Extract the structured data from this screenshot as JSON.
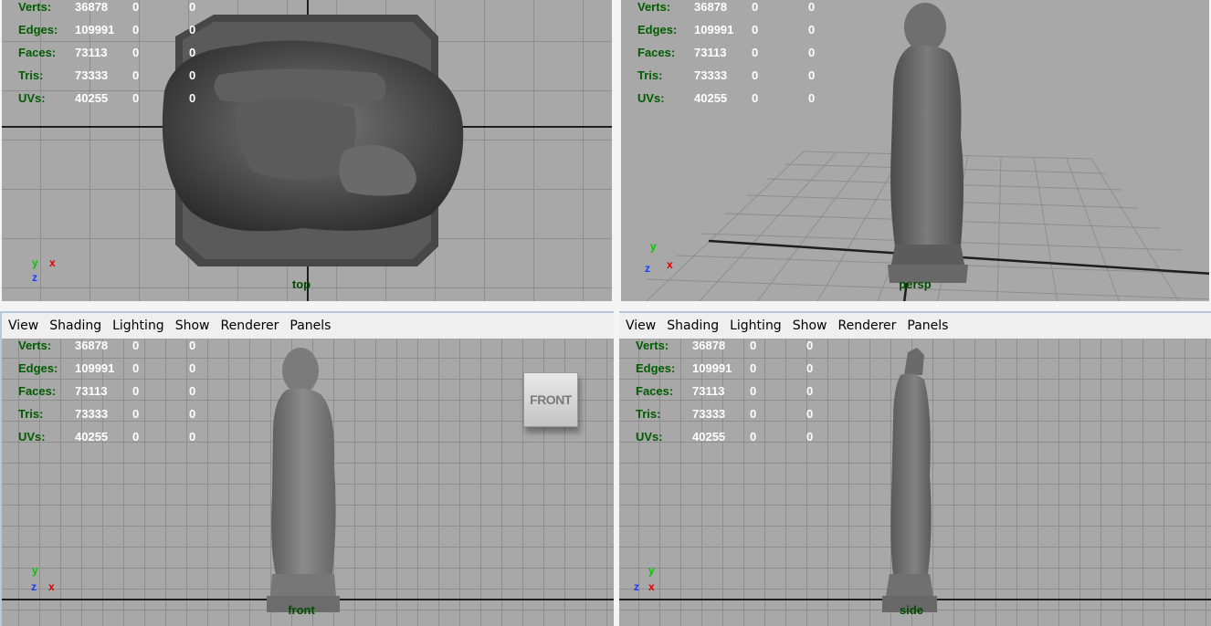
{
  "stats": {
    "labels": [
      "Verts:",
      "Edges:",
      "Faces:",
      "Tris:",
      "UVs:"
    ],
    "values": [
      [
        "36878",
        "0",
        "0"
      ],
      [
        "109991",
        "0",
        "0"
      ],
      [
        "73113",
        "0",
        "0"
      ],
      [
        "73333",
        "0",
        "0"
      ],
      [
        "40255",
        "0",
        "0"
      ]
    ]
  },
  "viewports": {
    "top": {
      "camera": "top"
    },
    "persp": {
      "camera": "persp"
    },
    "front": {
      "camera": "front",
      "viewcube": "FRONT"
    },
    "side": {
      "camera": "side"
    }
  },
  "menu": [
    "View",
    "Shading",
    "Lighting",
    "Show",
    "Renderer",
    "Panels"
  ],
  "gizmo": {
    "y": "y",
    "x": "x",
    "z": "z"
  },
  "colors": {
    "grid_bg": "#a8a8a8",
    "grid_line": "#8e8e8e",
    "hud_label": "#005d00",
    "hud_value": "#ffffff",
    "panel_bg": "#efefef"
  },
  "icons": {
    "viewcube": "viewcube-icon",
    "axis_gizmo": "axis-gizmo-icon"
  }
}
